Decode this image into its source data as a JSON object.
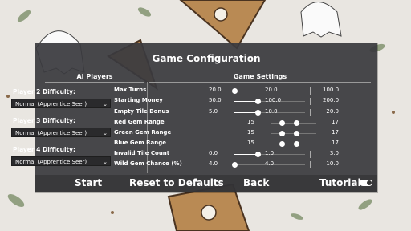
{
  "window": {
    "title": "Game Configuration"
  },
  "ai_players": {
    "heading": "AI Players",
    "players": [
      {
        "label": "Player 2 Difficulty:",
        "value": "Normal (Apprentice Seer)"
      },
      {
        "label": "Player 3 Difficulty:",
        "value": "Normal (Apprentice Seer)"
      },
      {
        "label": "Player 4 Difficulty:",
        "value": "Normal (Apprentice Seer)"
      }
    ]
  },
  "game_settings": {
    "heading": "Game Settings",
    "rows": [
      {
        "label": "Max Turns",
        "min": "20.0",
        "current": "20.0",
        "max": "100.0",
        "level": 0.0
      },
      {
        "label": "Starting Money",
        "min": "50.0",
        "current": "100.0",
        "max": "200.0",
        "level": 0.33
      },
      {
        "label": "Empty Tile Bonus",
        "min": "5.0",
        "current": "10.0",
        "max": "20.0",
        "level": 0.33
      },
      {
        "label": "Red Gem Range",
        "min": "15",
        "current": "",
        "max": "17",
        "level": 0.5
      },
      {
        "label": "Green Gem Range",
        "min": "15",
        "current": "",
        "max": "17",
        "level": 0.5
      },
      {
        "label": "Blue Gem Range",
        "min": "15",
        "current": "",
        "max": "17",
        "level": 0.5
      },
      {
        "label": "Invalid Tile Count",
        "min": "0.0",
        "current": "1.0",
        "max": "3.0",
        "level": 0.33
      },
      {
        "label": "Wild Gem Chance (%)",
        "min": "4.0",
        "current": "4.0",
        "max": "10.0",
        "level": 0.0
      }
    ]
  },
  "buttons": {
    "start": "Start",
    "reset": "Reset to Defaults",
    "back": "Back",
    "tutorial": "Tutorial"
  },
  "tutorial_toggle": {
    "on": true
  },
  "icons": {
    "dropdown": "chevron-down-icon"
  }
}
